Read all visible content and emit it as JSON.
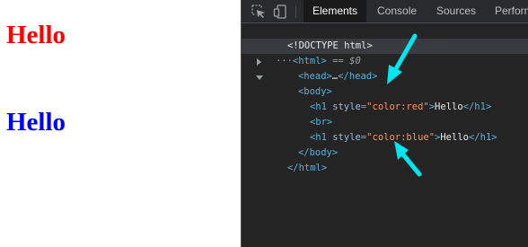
{
  "page": {
    "heading_red": "Hello",
    "heading_blue": "Hello"
  },
  "devtools": {
    "tabs": [
      {
        "label": "Elements",
        "active": true
      },
      {
        "label": "Console",
        "active": false
      },
      {
        "label": "Sources",
        "active": false
      },
      {
        "label": "Perform",
        "active": false
      }
    ],
    "tree": {
      "doctype": "<!DOCTYPE html>",
      "html_open": "<html>",
      "selected_marker": "== $0",
      "head": "<head>",
      "head_ellipsis": "…",
      "head_close": "</head>",
      "body_open": "<body>",
      "h1_red": {
        "open": "<h1 ",
        "attr": "style",
        "eq": "=",
        "value": "\"color:red\"",
        "close_bracket": ">",
        "text": "Hello",
        "close_tag": "</h1>"
      },
      "br": "<br>",
      "h1_blue": {
        "open": "<h1 ",
        "attr": "style",
        "eq": "=",
        "value": "\"color:blue\"",
        "close_bracket": ">",
        "text": "Hello",
        "close_tag": "</h1>"
      },
      "body_close": "</body>",
      "html_close": "</html>",
      "dots": "···"
    }
  },
  "colors": {
    "red_heading": "#ff0000",
    "blue_heading": "#0000ff",
    "annotation_arrow": "#00e5ee",
    "devtools_bg": "#242424"
  },
  "icons": {
    "inspect": "inspect-element-icon",
    "device": "device-toolbar-icon"
  }
}
